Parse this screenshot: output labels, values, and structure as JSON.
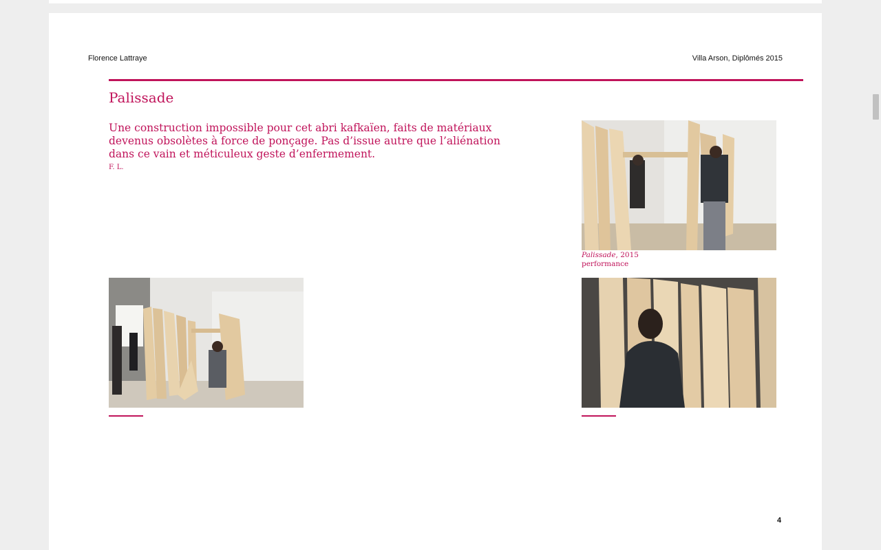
{
  "header": {
    "author": "Florence Lattraye",
    "context": "Villa Arson, Diplômés 2015"
  },
  "section": {
    "title": "Palissade",
    "intro": "Une construction impossible pour cet abri kafkaïen, faits de matériaux devenus obsolètes à force de ponçage. Pas d’issue autre que l’aliénation dans ce vain et méticuleux geste d’enfermement.",
    "initials": "F. L."
  },
  "caption": {
    "work_title": "Palissade",
    "year": ", 2015",
    "medium": "performance"
  },
  "footer": {
    "page_number": "4"
  },
  "colors": {
    "accent": "#c0135a",
    "page": "#ffffff",
    "background": "#eeeeee"
  }
}
